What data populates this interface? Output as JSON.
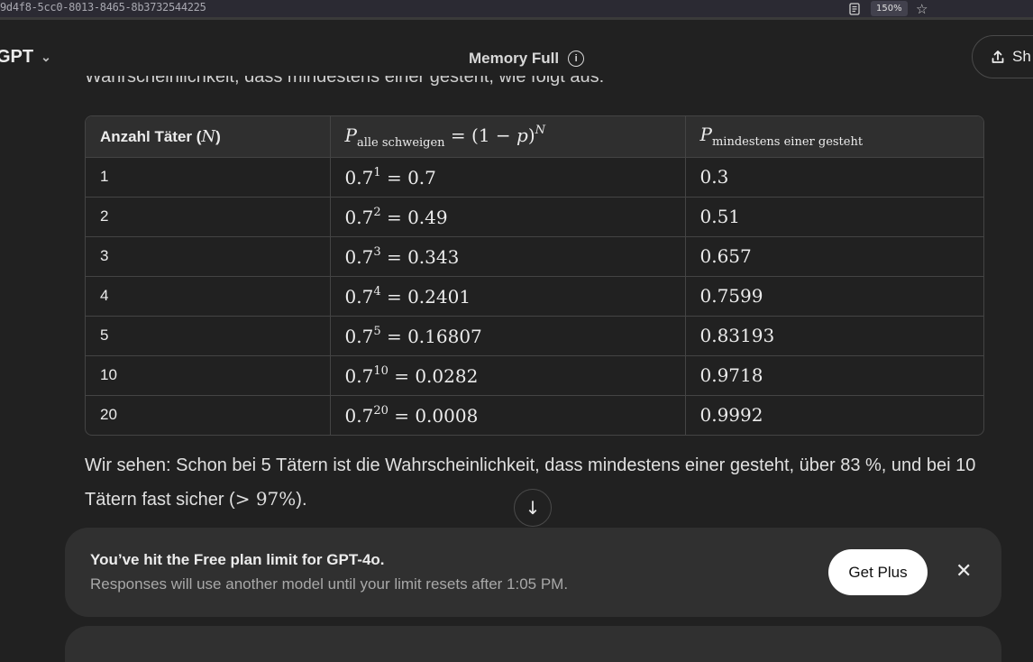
{
  "browser": {
    "url_fragment": "9d4f8-5cc0-8013-8465-8b3732544225",
    "zoom": "150%"
  },
  "header": {
    "model": "GPT",
    "memory_label": "Memory Full",
    "share_label": "Sh"
  },
  "message": {
    "cut_line": "Wahrscheinlichkeit, dass mindestens einer gesteht, wie folgt aus:",
    "table": {
      "headers": [
        "Anzahl Täter (N)",
        "P_alle schweigen = (1 − p)^N",
        "P_mindestens einer gesteht"
      ],
      "header_col1_prefix": "Anzahl Täter (",
      "header_col1_var": "N",
      "header_col1_suffix": ")",
      "header_col2_sub": "alle schweigen",
      "header_col2_rest": " = (1 − ",
      "header_col2_p": "p",
      "header_col2_close": ")",
      "header_col2_exp": "N",
      "header_col3_sub": "mindestens einer gesteht",
      "header_P": "P",
      "rows": [
        {
          "n": "1",
          "base": "0.7",
          "exp": "1",
          "value": " = 0.7",
          "prob": "0.3"
        },
        {
          "n": "2",
          "base": "0.7",
          "exp": "2",
          "value": " = 0.49",
          "prob": "0.51"
        },
        {
          "n": "3",
          "base": "0.7",
          "exp": "3",
          "value": " = 0.343",
          "prob": "0.657"
        },
        {
          "n": "4",
          "base": "0.7",
          "exp": "4",
          "value": " = 0.2401",
          "prob": "0.7599"
        },
        {
          "n": "5",
          "base": "0.7",
          "exp": "5",
          "value": " = 0.16807",
          "prob": "0.83193"
        },
        {
          "n": "10",
          "base": "0.7",
          "exp": "10",
          "value": " = 0.0282",
          "prob": "0.9718"
        },
        {
          "n": "20",
          "base": "0.7",
          "exp": "20",
          "value": " = 0.0008",
          "prob": "0.9992"
        }
      ]
    },
    "paragraph_a": "Wir sehen: Schon bei 5 Tätern ist die Wahrscheinlichkeit, dass mindestens einer gesteht, über 83 %, und bei 10 Tätern fast sicher (",
    "paragraph_math": "> 97%",
    "paragraph_b": ")."
  },
  "limit_banner": {
    "title": "You’ve hit the Free plan limit for GPT-4o.",
    "subtitle": "Responses will use another model until your limit resets after 1:05 PM.",
    "button": "Get Plus"
  }
}
